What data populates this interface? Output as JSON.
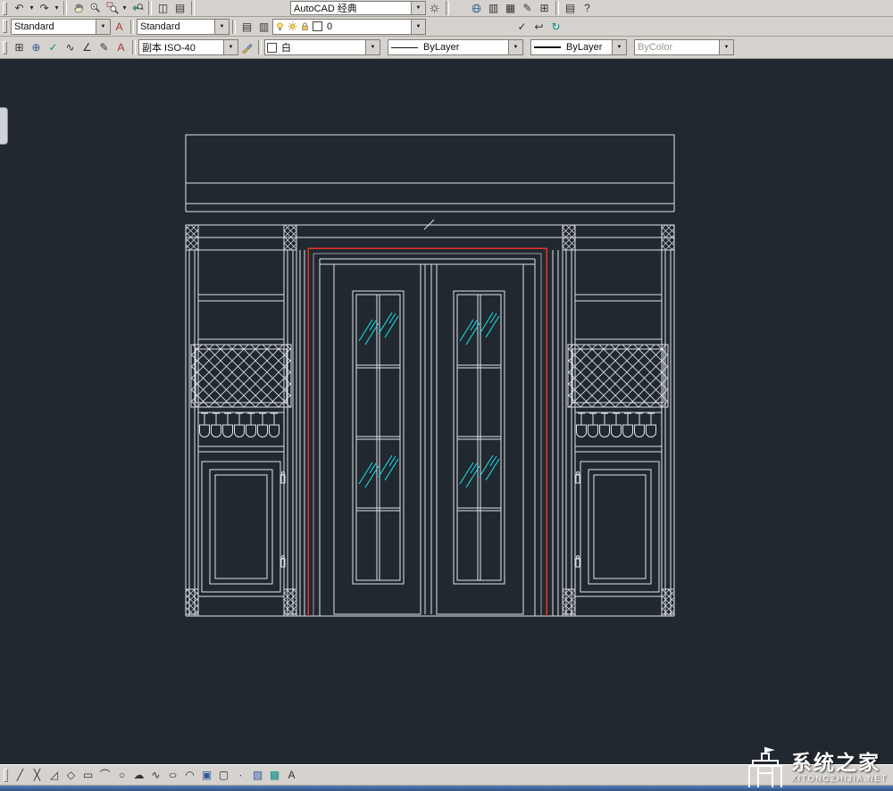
{
  "app": {
    "workspace": "AutoCAD 经典"
  },
  "styles": {
    "style1": "Standard",
    "style2": "Standard",
    "dim_style": "副本 ISO-40"
  },
  "layer": {
    "current": "0"
  },
  "props": {
    "color": "白",
    "linetype": "ByLayer",
    "lineweight": "ByLayer",
    "plot_style": "ByColor"
  },
  "watermark": {
    "title": "系统之家",
    "subtitle": "XITONGZHIJIA.NET"
  },
  "colors": {
    "canvas_bg": "#212830",
    "toolbar_bg": "#d6d3ce",
    "line_white": "#dfe3e6",
    "door_red": "#e8342a",
    "glass_cyan": "#19e3e8"
  },
  "icons": {
    "undo": "↶",
    "redo": "↷",
    "plot_preview": "◫",
    "properties": "▤",
    "toolpalettes": "▥",
    "sheetset": "▦",
    "markup": "✎",
    "quickcalc": "⊞",
    "help": "?",
    "style_mgr": "A",
    "layer_props": "▤",
    "layer_states": "▥",
    "make_current": "✓",
    "layer_prev": "↩",
    "layer_sync": "↻",
    "edit": [
      "⊞",
      "⊕",
      "✓",
      "∿",
      "∠",
      "✎",
      "A"
    ],
    "draw": [
      "╱",
      "╳",
      "◿",
      "◇",
      "▭",
      "⌒",
      "○",
      "☁",
      "∿",
      "○",
      "◠",
      "▣",
      "▢",
      "∙",
      "▨",
      "▩",
      "A"
    ]
  }
}
